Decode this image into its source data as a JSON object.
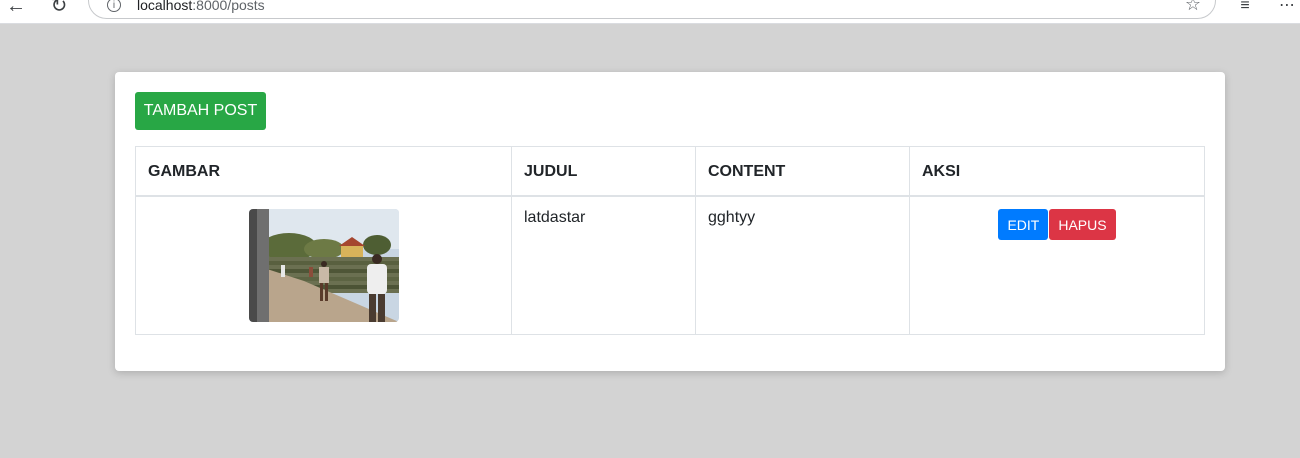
{
  "browser": {
    "url_host": "localhost",
    "url_rest": ":8000/posts"
  },
  "page": {
    "add_button_label": "TAMBAH POST"
  },
  "table": {
    "headers": [
      "GAMBAR",
      "JUDUL",
      "CONTENT",
      "AKSI"
    ],
    "rows": [
      {
        "judul": "latdastar",
        "content": "gghtyy",
        "edit_label": "EDIT",
        "delete_label": "HAPUS"
      }
    ]
  },
  "colors": {
    "success": "#28a745",
    "primary": "#007bff",
    "danger": "#dc3545",
    "background": "#d3d3d3"
  }
}
